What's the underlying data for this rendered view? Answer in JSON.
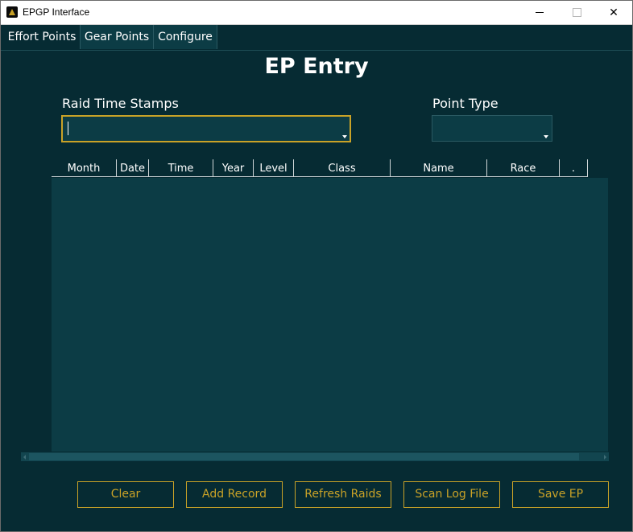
{
  "window": {
    "title": "EPGP Interface",
    "close_glyph": "✕"
  },
  "tabs": [
    {
      "label": "Effort Points",
      "active": true
    },
    {
      "label": "Gear Points",
      "active": false
    },
    {
      "label": "Configure",
      "active": false
    }
  ],
  "page": {
    "heading": "EP Entry"
  },
  "form": {
    "raid_label": "Raid Time Stamps",
    "raid_value": "",
    "point_type_label": "Point Type",
    "point_type_value": ""
  },
  "table": {
    "columns": [
      "Month",
      "Date",
      "Time",
      "Year",
      "Level",
      "Class",
      "Name",
      "Race",
      "."
    ],
    "rows": []
  },
  "buttons": {
    "clear": "Clear",
    "add_record": "Add Record",
    "refresh_raids": "Refresh Raids",
    "scan_log_file": "Scan Log File",
    "save_ep": "Save EP"
  },
  "colors": {
    "background": "#062b33",
    "panel": "#0c3c45",
    "accent": "#c9a227",
    "text": "#ffffff"
  },
  "icons": {
    "app": "app-logo-icon",
    "minimize": "minimize-icon",
    "maximize": "maximize-icon",
    "close": "close-icon",
    "dropdown": "chevron-down-icon"
  }
}
